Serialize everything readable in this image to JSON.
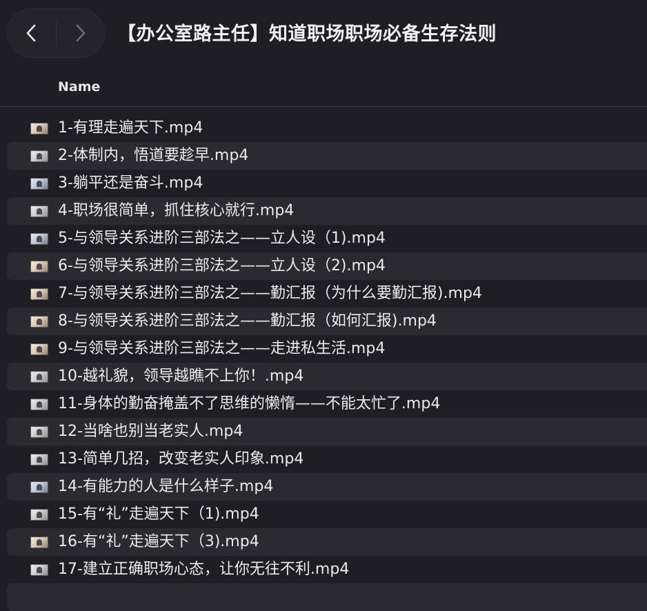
{
  "window": {
    "title": "【办公室路主任】知道职场职场必备生存法则",
    "back_icon": "chevron-left-icon",
    "forward_icon": "chevron-right-icon"
  },
  "columns": {
    "name": "Name"
  },
  "files": [
    {
      "name": "1-有理走遍天下.mp4",
      "icon": "video-thumbnail-icon"
    },
    {
      "name": "2-体制内，悟道要趁早.mp4",
      "icon": "video-thumbnail-icon"
    },
    {
      "name": "3-躺平还是奋斗.mp4",
      "icon": "video-thumbnail-icon"
    },
    {
      "name": "4-职场很简单，抓住核心就行.mp4",
      "icon": "video-thumbnail-icon"
    },
    {
      "name": "5-与领导关系进阶三部法之——立人设（1).mp4",
      "icon": "video-thumbnail-icon"
    },
    {
      "name": "6-与领导关系进阶三部法之——立人设（2).mp4",
      "icon": "video-thumbnail-icon"
    },
    {
      "name": "7-与领导关系进阶三部法之——勤汇报（为什么要勤汇报).mp4",
      "icon": "video-thumbnail-icon"
    },
    {
      "name": "8-与领导关系进阶三部法之——勤汇报（如何汇报).mp4",
      "icon": "video-thumbnail-icon"
    },
    {
      "name": "9-与领导关系进阶三部法之——走进私生活.mp4",
      "icon": "video-thumbnail-icon"
    },
    {
      "name": "10-越礼貌，领导越瞧不上你！.mp4",
      "icon": "video-thumbnail-icon"
    },
    {
      "name": "11-身体的勤奋掩盖不了思维的懒惰——不能太忙了.mp4",
      "icon": "video-thumbnail-icon"
    },
    {
      "name": "12-当啥也别当老实人.mp4",
      "icon": "video-thumbnail-icon"
    },
    {
      "name": "13-简单几招，改变老实人印象.mp4",
      "icon": "video-thumbnail-icon"
    },
    {
      "name": "14-有能力的人是什么样子.mp4",
      "icon": "video-thumbnail-icon"
    },
    {
      "name": "15-有“礼”走遍天下（1).mp4",
      "icon": "video-thumbnail-icon"
    },
    {
      "name": "16-有“礼”走遍天下（3).mp4",
      "icon": "video-thumbnail-icon"
    },
    {
      "name": "17-建立正确职场心态，让你无往不利.mp4",
      "icon": "video-thumbnail-icon"
    }
  ],
  "colors": {
    "background": "#1f1f23",
    "row_alternate": "#2a2a2f",
    "text": "#ececee"
  }
}
